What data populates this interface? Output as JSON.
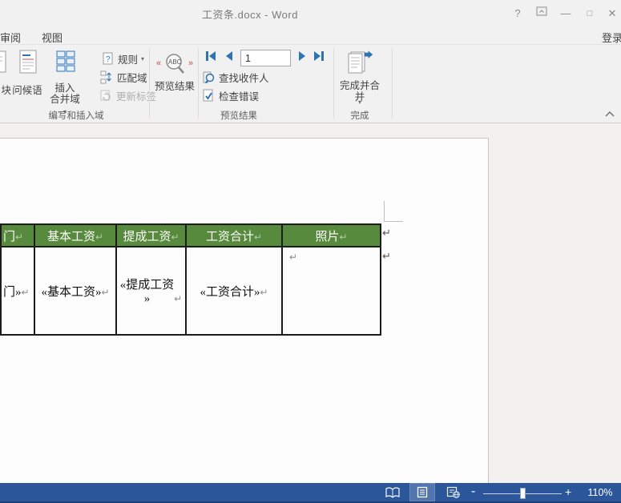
{
  "colors": {
    "table_header_bg": "#578A3C",
    "status_bar_blue": "#2B579A",
    "accent_blue": "#2E74B5",
    "accent_red": "#C0504D"
  },
  "icons": {
    "dropdown": "▾",
    "pilcrow": "↵",
    "help": "?",
    "minimize": "—",
    "restore": "□",
    "close": "✕",
    "zoom_minus": "-",
    "zoom_plus": "+"
  },
  "titlebar": {
    "title": "工资条.docx - Word"
  },
  "tabs": {
    "review": "审阅",
    "view": "视图",
    "signin": "登录"
  },
  "ribbon": {
    "write_insert": {
      "label": "编写和插入域",
      "address_block_partial": "块",
      "greeting_line": "问候语",
      "insert_merge_line1": "插入",
      "insert_merge_line2": "合并域",
      "rules": "规则",
      "match_fields": "匹配域",
      "update_labels": "更新标签"
    },
    "preview": {
      "label": "预览结果",
      "preview_results": "预览结果",
      "record_value": "1",
      "find_recipient": "查找收件人",
      "check_errors": "检查错误"
    },
    "finish": {
      "label": "完成",
      "finish_merge": "完成并合并"
    }
  },
  "document": {
    "table": {
      "headers": [
        "门",
        "基本工资",
        "提成工资",
        "工资合计",
        "照片"
      ],
      "fields": [
        "门»",
        "«基本工资»",
        "«提成工资\n»",
        "«工资合计»"
      ]
    }
  },
  "statusbar": {
    "zoom_level": "110%"
  }
}
